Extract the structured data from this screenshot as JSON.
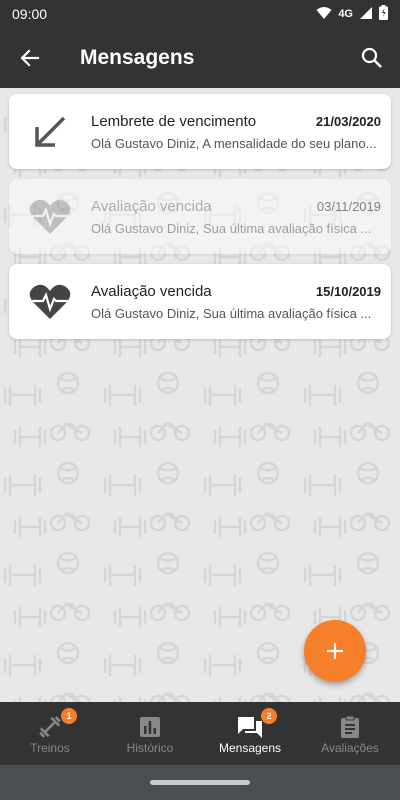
{
  "status_bar": {
    "time": "09:00",
    "network": "4G"
  },
  "app_bar": {
    "title": "Mensagens"
  },
  "messages": [
    {
      "icon": "arrow-down-left-icon",
      "subject": "Lembrete de vencimento",
      "date": "21/03/2020",
      "preview": "Olá Gustavo Diniz, A mensalidade do seu plano...",
      "read": false
    },
    {
      "icon": "heart-pulse-icon",
      "subject": "Avaliação vencida",
      "date": "03/11/2019",
      "preview": "Olá Gustavo Diniz, Sua última avaliação física ...",
      "read": true
    },
    {
      "icon": "heart-pulse-icon",
      "subject": "Avaliação vencida",
      "date": "15/10/2019",
      "preview": "Olá Gustavo Diniz, Sua última avaliação física ...",
      "read": false
    }
  ],
  "fab": {
    "icon": "plus-icon"
  },
  "bottom_nav": [
    {
      "label": "Treinos",
      "icon": "dumbbell-icon",
      "badge": "1",
      "active": false
    },
    {
      "label": "Histórico",
      "icon": "bar-chart-icon",
      "badge": "",
      "active": false
    },
    {
      "label": "Mensagens",
      "icon": "chat-icon",
      "badge": "2",
      "active": true
    },
    {
      "label": "Avaliações",
      "icon": "clipboard-icon",
      "badge": "",
      "active": false
    }
  ],
  "colors": {
    "accent": "#f57f2a",
    "bar": "#333333",
    "background": "#e8e8e8"
  }
}
